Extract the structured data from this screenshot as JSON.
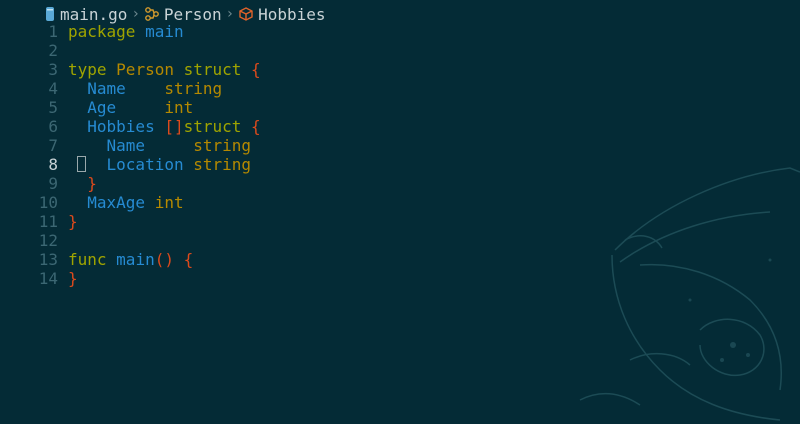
{
  "breadcrumb": {
    "file": "main.go",
    "symbols": [
      "Person",
      "Hobbies"
    ]
  },
  "editor": {
    "active_line": 8,
    "lines": [
      {
        "n": "1",
        "tokens": [
          {
            "t": "package",
            "c": "kw"
          },
          {
            "t": " "
          },
          {
            "t": "main",
            "c": "fn"
          }
        ]
      },
      {
        "n": "2",
        "tokens": []
      },
      {
        "n": "3",
        "tokens": [
          {
            "t": "type",
            "c": "kw"
          },
          {
            "t": " "
          },
          {
            "t": "Person",
            "c": "ty"
          },
          {
            "t": " "
          },
          {
            "t": "struct",
            "c": "kw"
          },
          {
            "t": " "
          },
          {
            "t": "{",
            "c": "pun"
          }
        ]
      },
      {
        "n": "4",
        "tokens": [
          {
            "t": "  "
          },
          {
            "t": "Name",
            "c": "fn"
          },
          {
            "t": "    "
          },
          {
            "t": "string",
            "c": "ty"
          }
        ]
      },
      {
        "n": "5",
        "tokens": [
          {
            "t": "  "
          },
          {
            "t": "Age",
            "c": "fn"
          },
          {
            "t": "     "
          },
          {
            "t": "int",
            "c": "ty"
          }
        ]
      },
      {
        "n": "6",
        "tokens": [
          {
            "t": "  "
          },
          {
            "t": "Hobbies",
            "c": "fn"
          },
          {
            "t": " "
          },
          {
            "t": "[]",
            "c": "pun"
          },
          {
            "t": "struct",
            "c": "kw"
          },
          {
            "t": " "
          },
          {
            "t": "{",
            "c": "pun"
          }
        ]
      },
      {
        "n": "7",
        "tokens": [
          {
            "t": "    "
          },
          {
            "t": "Name",
            "c": "fn"
          },
          {
            "t": "     "
          },
          {
            "t": "string",
            "c": "ty"
          }
        ]
      },
      {
        "n": "8",
        "tokens": [
          {
            "t": "    "
          },
          {
            "t": "Location",
            "c": "fn"
          },
          {
            "t": " "
          },
          {
            "t": "string",
            "c": "ty"
          }
        ]
      },
      {
        "n": "9",
        "tokens": [
          {
            "t": "  "
          },
          {
            "t": "}",
            "c": "pun"
          }
        ]
      },
      {
        "n": "10",
        "tokens": [
          {
            "t": "  "
          },
          {
            "t": "MaxAge",
            "c": "fn"
          },
          {
            "t": " "
          },
          {
            "t": "int",
            "c": "ty"
          }
        ]
      },
      {
        "n": "11",
        "tokens": [
          {
            "t": "}",
            "c": "pun"
          }
        ]
      },
      {
        "n": "12",
        "tokens": []
      },
      {
        "n": "13",
        "tokens": [
          {
            "t": "func",
            "c": "kw"
          },
          {
            "t": " "
          },
          {
            "t": "main",
            "c": "fn"
          },
          {
            "t": "()",
            "c": "pun"
          },
          {
            "t": " "
          },
          {
            "t": "{",
            "c": "pun"
          }
        ]
      },
      {
        "n": "14",
        "tokens": [
          {
            "t": "}",
            "c": "pun"
          }
        ]
      }
    ]
  },
  "colors": {
    "background": "#042b36",
    "keyword": "#9fa400",
    "type": "#b58900",
    "identifier": "#268bd2",
    "punctuation": "#dc4a1c",
    "line_number": "#3c6773"
  }
}
